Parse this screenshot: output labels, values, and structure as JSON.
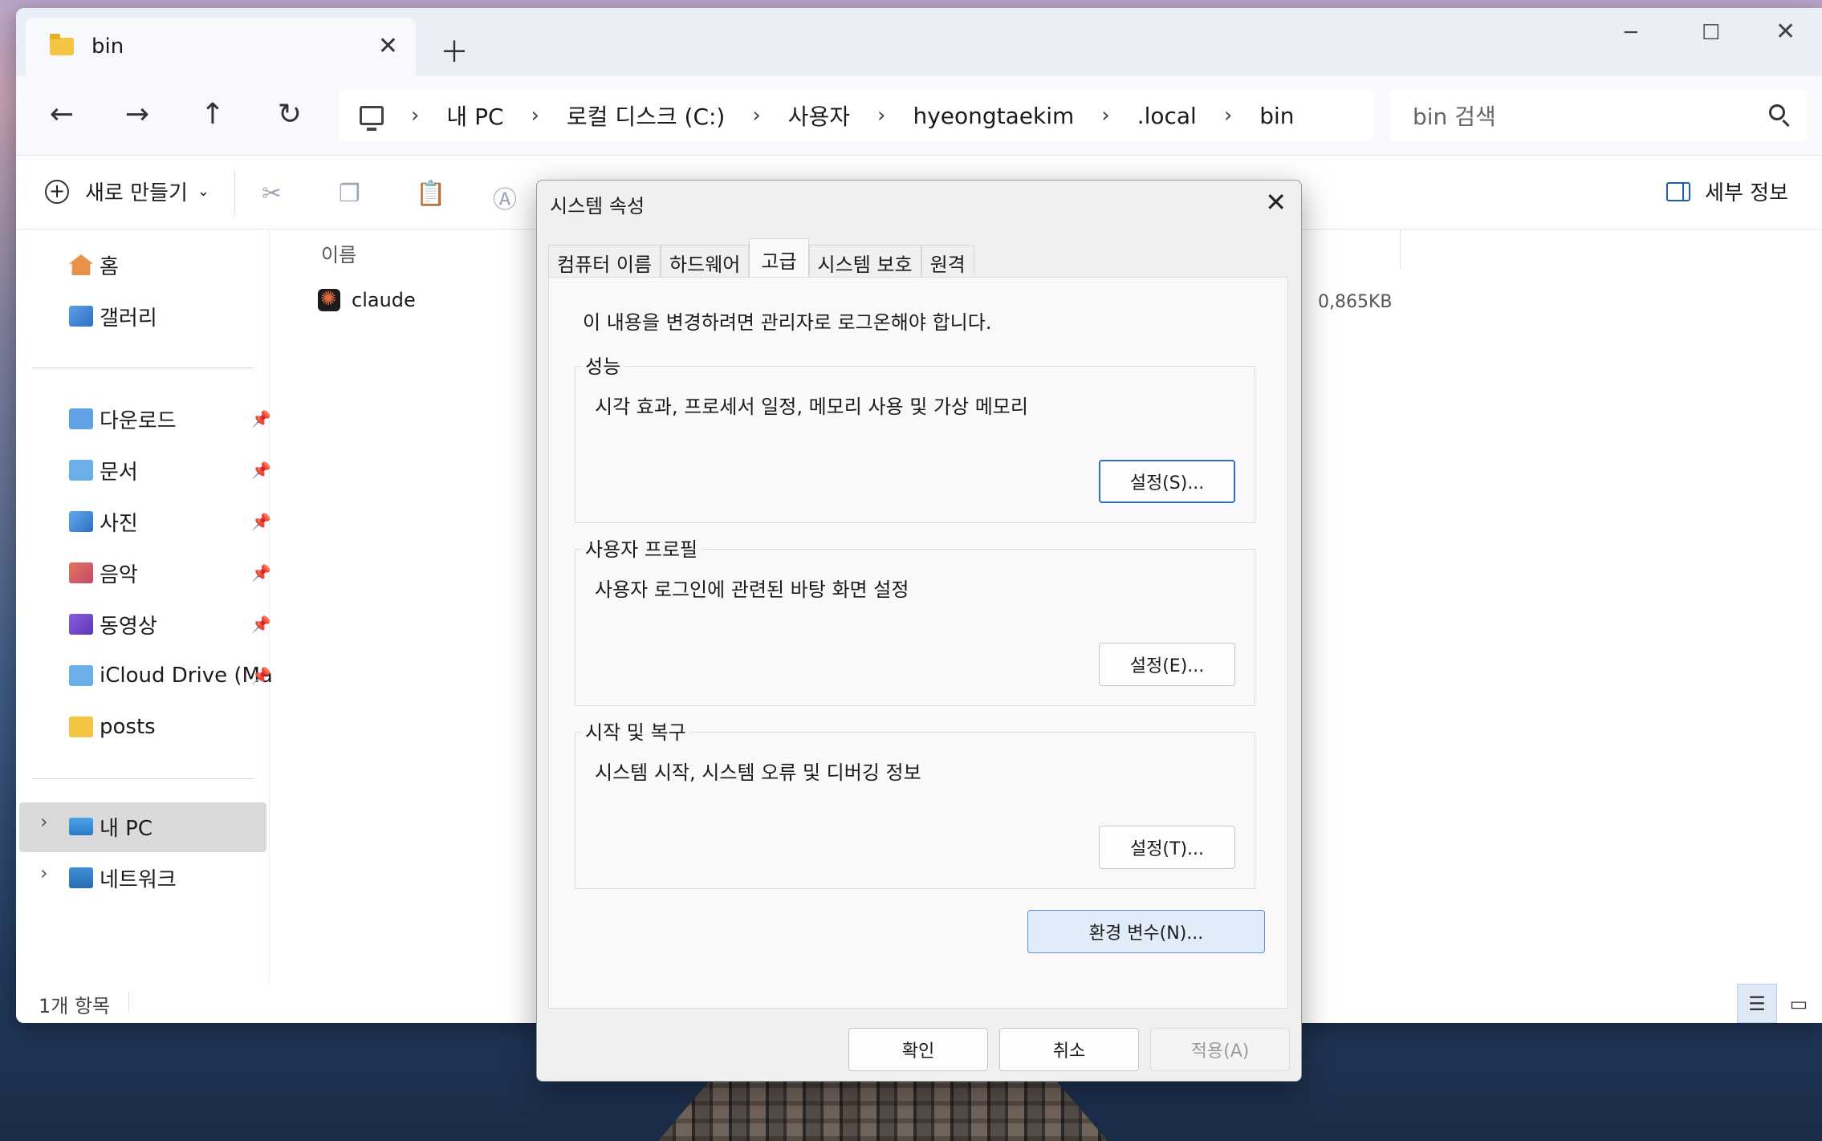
{
  "explorer": {
    "tab_title": "bin",
    "address": [
      "내 PC",
      "로컬 디스크 (C:)",
      "사용자",
      "hyeongtaekim",
      ".local",
      "bin"
    ],
    "search_placeholder": "bin 검색",
    "new_label": "새로 만들기",
    "details_label": "세부 정보",
    "sidebar": {
      "quick": [
        {
          "label": "홈",
          "icon": "home-icon"
        },
        {
          "label": "갤러리",
          "icon": "gallery-icon"
        }
      ],
      "pinned": [
        {
          "label": "다운로드",
          "icon": "downloads-folder-icon"
        },
        {
          "label": "문서",
          "icon": "documents-folder-icon"
        },
        {
          "label": "사진",
          "icon": "pictures-folder-icon"
        },
        {
          "label": "음악",
          "icon": "music-folder-icon"
        },
        {
          "label": "동영상",
          "icon": "videos-folder-icon"
        },
        {
          "label": "iCloud Drive (Ma",
          "icon": "icloud-folder-icon"
        },
        {
          "label": "posts",
          "icon": "folder-icon"
        }
      ],
      "this_pc": "내 PC",
      "network": "네트워크"
    },
    "column_name": "이름",
    "files": [
      {
        "name": "claude",
        "size": "0,865KB"
      }
    ],
    "status": "1개 항목"
  },
  "dialog": {
    "title": "시스템 속성",
    "tabs": [
      "컴퓨터 이름",
      "하드웨어",
      "고급",
      "시스템 보호",
      "원격"
    ],
    "active_tab": "고급",
    "admin_note": "이 내용을 변경하려면 관리자로 로그온해야 합니다.",
    "groups": [
      {
        "label": "성능",
        "desc": "시각 효과, 프로세서 일정, 메모리 사용 및 가상 메모리",
        "button": "설정(S)..."
      },
      {
        "label": "사용자 프로필",
        "desc": "사용자 로그인에 관련된 바탕 화면 설정",
        "button": "설정(E)..."
      },
      {
        "label": "시작 및 복구",
        "desc": "시스템 시작, 시스템 오류 및 디버깅 정보",
        "button": "설정(T)..."
      }
    ],
    "env_button": "환경 변수(N)...",
    "ok": "확인",
    "cancel": "취소",
    "apply": "적용(A)"
  }
}
